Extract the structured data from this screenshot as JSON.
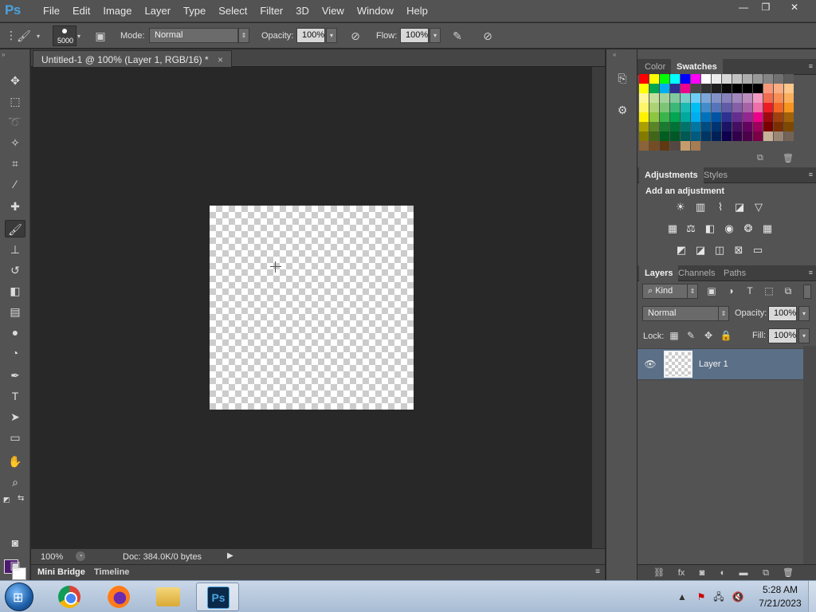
{
  "app": {
    "logo": "Ps"
  },
  "menu": [
    "File",
    "Edit",
    "Image",
    "Layer",
    "Type",
    "Select",
    "Filter",
    "3D",
    "View",
    "Window",
    "Help"
  ],
  "window_controls": {
    "minimize": "—",
    "restore": "❐",
    "close": "✕"
  },
  "options": {
    "brush_size": "5000",
    "mode_label": "Mode:",
    "mode_value": "Normal",
    "opacity_label": "Opacity:",
    "opacity_value": "100%",
    "flow_label": "Flow:",
    "flow_value": "100%"
  },
  "document": {
    "tab_title": "Untitled-1 @ 100% (Layer 1, RGB/16) *",
    "close": "×",
    "zoom": "100%",
    "doc_size": "Doc: 384.0K/0 bytes",
    "status_arrow": "▶"
  },
  "bottom_tabs": [
    "Mini Bridge",
    "Timeline"
  ],
  "colors": {
    "foreground": "#4b1a6e",
    "background": "#ffffff",
    "selection": "#5b6f87",
    "accent": "#4aa3df"
  },
  "swatches_panel": {
    "tabs": [
      "Color",
      "Swatches"
    ],
    "active": "Swatches"
  },
  "swatches": [
    [
      "#ff0000",
      "#ffff00",
      "#00ff00",
      "#00ffff",
      "#0000ff",
      "#ff00ff",
      "#ffffff",
      "#ebebeb",
      "#d6d6d6",
      "#c2c2c2",
      "#adadad",
      "#999999",
      "#858585",
      "#707070",
      "#5c5c5c"
    ],
    [
      "#ffff00",
      "#00a651",
      "#00aeef",
      "#2e3192",
      "#ec008c",
      "#474747",
      "#333333",
      "#1f1f1f",
      "#0a0a0a",
      "#000000",
      "#000000",
      "#000000",
      "#f7977a",
      "#f9ad81",
      "#fdc68a"
    ],
    [
      "#fff79a",
      "#c4df9b",
      "#a3d39c",
      "#82ca9d",
      "#7bcdc8",
      "#6dcff6",
      "#7da7d9",
      "#8393ca",
      "#8781bd",
      "#a187be",
      "#bd8cbf",
      "#f49ac2",
      "#f26c4f",
      "#f68e56",
      "#fbaf5d"
    ],
    [
      "#fff568",
      "#acd373",
      "#7cc576",
      "#3bb878",
      "#1abbb4",
      "#00bff3",
      "#438ccb",
      "#5674b9",
      "#605ca8",
      "#855fa8",
      "#a763a8",
      "#f06eaa",
      "#ed1c24",
      "#f26522",
      "#f7941d"
    ],
    [
      "#fff200",
      "#8dc63f",
      "#39b54a",
      "#00a651",
      "#00a99d",
      "#00aeef",
      "#0072bc",
      "#0054a6",
      "#2e3192",
      "#662d91",
      "#92278f",
      "#ec008c",
      "#9e0b0f",
      "#a0410d",
      "#a36209"
    ],
    [
      "#aba000",
      "#598527",
      "#1a7b30",
      "#007236",
      "#00746b",
      "#0076a3",
      "#004b80",
      "#003471",
      "#1b1464",
      "#440e62",
      "#630460",
      "#9e005d",
      "#790000",
      "#7b2e00",
      "#7d4900"
    ],
    [
      "#827b00",
      "#406618",
      "#005e20",
      "#005826",
      "#005952",
      "#005b7f",
      "#003663",
      "#002157",
      "#0d004c",
      "#32004b",
      "#4b0049",
      "#7b0046",
      "#c7b299",
      "#998675",
      "#736357"
    ],
    [
      "#8c6239",
      "#754c24",
      "#603913",
      "#534741",
      "#c69c6d",
      "#a67c52"
    ]
  ],
  "adjustments_panel": {
    "tabs": [
      "Adjustments",
      "Styles"
    ],
    "active": "Adjustments",
    "title": "Add an adjustment"
  },
  "layers_panel": {
    "tabs": [
      "Layers",
      "Channels",
      "Paths"
    ],
    "active": "Layers",
    "filter_kind": "Kind",
    "blend_mode": "Normal",
    "opacity_label": "Opacity:",
    "opacity_value": "100%",
    "lock_label": "Lock:",
    "fill_label": "Fill:",
    "fill_value": "100%",
    "layers": [
      {
        "name": "Layer 1",
        "visible": true,
        "selected": true
      }
    ]
  },
  "taskbar": {
    "time": "5:28 AM",
    "date": "7/21/2023",
    "apps": [
      "chrome",
      "firefox",
      "file-explorer",
      "photoshop"
    ],
    "active_app": "photoshop",
    "ps_label": "Ps"
  }
}
